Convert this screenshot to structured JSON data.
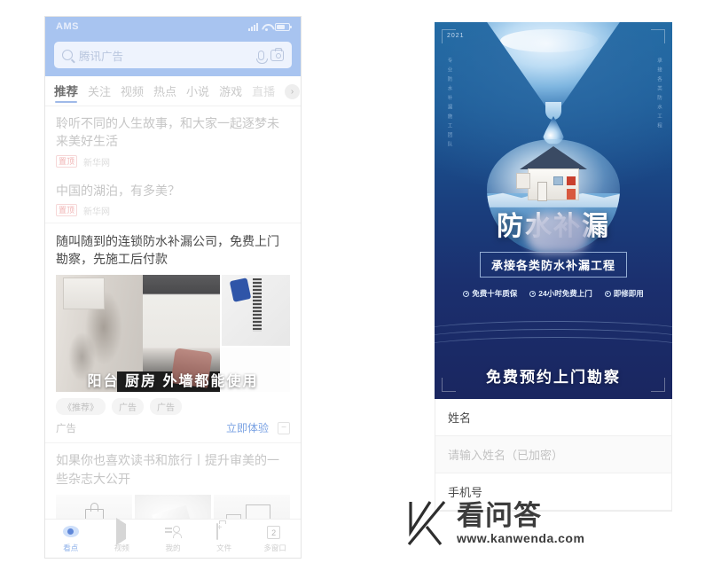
{
  "phone": {
    "status_bar": {
      "carrier": "AMS",
      "icons": [
        "signal-icon",
        "wifi-icon",
        "battery-icon"
      ]
    },
    "search": {
      "placeholder": "腾讯广告",
      "icons": [
        "search-icon",
        "microphone-icon",
        "camera-icon"
      ]
    },
    "tabs": [
      {
        "label": "推荐",
        "active": true
      },
      {
        "label": "关注",
        "active": false
      },
      {
        "label": "视频",
        "active": false
      },
      {
        "label": "热点",
        "active": false
      },
      {
        "label": "小说",
        "active": false
      },
      {
        "label": "游戏",
        "active": false
      },
      {
        "label": "直播",
        "active": false
      }
    ],
    "tab_more": "›",
    "news": [
      {
        "title": "聆听不同的人生故事，和大家一起逐梦未来美好生活",
        "pin": "置顶",
        "source": "新华网"
      },
      {
        "title": "中国的湖泊，有多美？",
        "pin": "置顶",
        "source": "新华网"
      }
    ],
    "ad": {
      "title": "随叫随到的连锁防水补漏公司，免费上门勘察，先施工后付款",
      "media_caption": "阳台 厨房 外墙都能使用",
      "tags": [
        "《推荐》",
        "广告",
        "广告"
      ],
      "footer_label": "广告",
      "cta": "立即体验",
      "close": "−"
    },
    "news2": {
      "title": "如果你也喜欢读书和旅行丨提升审美的一些杂志大公开"
    },
    "bottom_nav": [
      {
        "label": "看点",
        "icon": "eye-icon",
        "active": true
      },
      {
        "label": "视频",
        "icon": "play-icon",
        "active": false
      },
      {
        "label": "我的",
        "icon": "person-icon",
        "active": false
      },
      {
        "label": "文件",
        "icon": "folder-add-icon",
        "active": false
      },
      {
        "label": "多窗口",
        "icon": "windows-icon",
        "badge": "2",
        "active": false
      }
    ]
  },
  "poster": {
    "year": "2021",
    "vertical_left": "专业防水补漏施工团队",
    "vertical_right": "承接各类防水工程",
    "headline": "防水补漏",
    "subtitle": "承接各类防水补漏工程",
    "features": [
      "免费十年质保",
      "24小时免费上门",
      "即修即用"
    ],
    "cta": "免费预约上门勘察"
  },
  "form": {
    "rows": [
      {
        "label": "姓名",
        "type": "label"
      },
      {
        "label": "请输入姓名（已加密）",
        "type": "placeholder"
      },
      {
        "label": "手机号",
        "type": "label"
      }
    ]
  },
  "watermark": {
    "name": "看问答",
    "url": "www.kanwenda.com",
    "logo": "k-logo-icon"
  },
  "colors": {
    "phone_header": "#a8c4f0",
    "poster_blue": "#1a3f7e",
    "cta_link": "#7aa2e3",
    "accent_pin": "#f0b3b3"
  }
}
